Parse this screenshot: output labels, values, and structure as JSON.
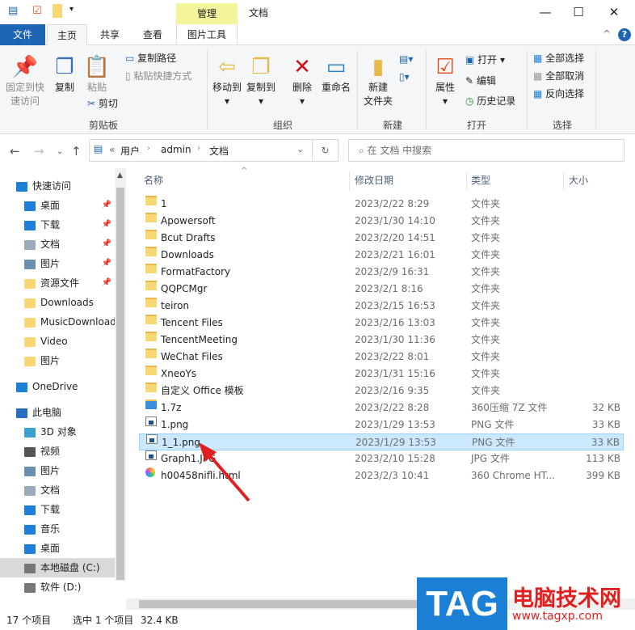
{
  "window": {
    "title": "文档",
    "context_tab": "管理",
    "minimize": "—",
    "maximize": "☐",
    "close": "✕"
  },
  "tabs": [
    {
      "label": "文件"
    },
    {
      "label": "主页"
    },
    {
      "label": "共享"
    },
    {
      "label": "查看"
    },
    {
      "label": "图片工具"
    }
  ],
  "ribbon": {
    "clipboard": {
      "pin": "固定到快速访问",
      "pin1": "固定到快",
      "pin2": "速访问",
      "copy": "复制",
      "paste": "粘贴",
      "copy_path": "复制路径",
      "paste_shortcut": "粘贴快捷方式",
      "cut": "剪切",
      "group": "剪贴板"
    },
    "organize": {
      "move_to": "移动到",
      "copy_to": "复制到",
      "delete": "删除",
      "rename": "重命名",
      "group": "组织"
    },
    "new": {
      "new_folder1": "新建",
      "new_folder2": "文件夹",
      "group": "新建"
    },
    "open": {
      "properties": "属性",
      "open": "打开",
      "edit": "编辑",
      "history": "历史记录",
      "group": "打开"
    },
    "select": {
      "select_all": "全部选择",
      "select_none": "全部取消",
      "invert": "反向选择",
      "group": "选择"
    }
  },
  "address": {
    "overflow": "«",
    "crumbs": [
      "用户",
      "admin",
      "文档"
    ],
    "search_placeholder": "在 文档 中搜索"
  },
  "sidebar": [
    {
      "label": "快速访问",
      "icon": "star-icon",
      "pinned": false
    },
    {
      "label": "桌面",
      "icon": "desktop-icon",
      "pinned": true
    },
    {
      "label": "下载",
      "icon": "download-icon",
      "pinned": true
    },
    {
      "label": "文档",
      "icon": "document-icon",
      "pinned": true
    },
    {
      "label": "图片",
      "icon": "pictures-icon",
      "pinned": true
    },
    {
      "label": "资源文件",
      "icon": "folder-icon",
      "pinned": true
    },
    {
      "label": "Downloads",
      "icon": "folder-icon",
      "pinned": false
    },
    {
      "label": "MusicDownload",
      "icon": "folder-icon",
      "pinned": false
    },
    {
      "label": "Video",
      "icon": "folder-icon",
      "pinned": false
    },
    {
      "label": "图片",
      "icon": "folder-icon",
      "pinned": false
    },
    {
      "label": "OneDrive",
      "icon": "cloud-icon",
      "pinned": false
    },
    {
      "label": "此电脑",
      "icon": "computer-icon",
      "pinned": false
    },
    {
      "label": "3D 对象",
      "icon": "cube-icon",
      "pinned": false
    },
    {
      "label": "视频",
      "icon": "video-icon",
      "pinned": false
    },
    {
      "label": "图片",
      "icon": "pictures-icon",
      "pinned": false
    },
    {
      "label": "文档",
      "icon": "document-icon",
      "pinned": false
    },
    {
      "label": "下载",
      "icon": "download-icon",
      "pinned": false
    },
    {
      "label": "音乐",
      "icon": "music-icon",
      "pinned": false
    },
    {
      "label": "桌面",
      "icon": "desktop-icon",
      "pinned": false
    },
    {
      "label": "本地磁盘 (C:)",
      "icon": "drive-icon",
      "pinned": false,
      "selected": true
    },
    {
      "label": "软件 (D:)",
      "icon": "drive-icon",
      "pinned": false
    }
  ],
  "columns": {
    "name": "名称",
    "date": "修改日期",
    "type": "类型",
    "size": "大小"
  },
  "files": [
    {
      "name": "1",
      "date": "2023/2/22 8:29",
      "type": "文件夹",
      "size": "",
      "icon": "folder"
    },
    {
      "name": "Apowersoft",
      "date": "2023/1/30 14:10",
      "type": "文件夹",
      "size": "",
      "icon": "folder"
    },
    {
      "name": "Bcut Drafts",
      "date": "2023/2/20 14:51",
      "type": "文件夹",
      "size": "",
      "icon": "folder"
    },
    {
      "name": "Downloads",
      "date": "2023/2/21 16:01",
      "type": "文件夹",
      "size": "",
      "icon": "folder"
    },
    {
      "name": "FormatFactory",
      "date": "2023/2/9 16:31",
      "type": "文件夹",
      "size": "",
      "icon": "folder"
    },
    {
      "name": "QQPCMgr",
      "date": "2023/2/1 8:16",
      "type": "文件夹",
      "size": "",
      "icon": "folder"
    },
    {
      "name": "teiron",
      "date": "2023/2/15 16:53",
      "type": "文件夹",
      "size": "",
      "icon": "folder"
    },
    {
      "name": "Tencent Files",
      "date": "2023/2/16 13:03",
      "type": "文件夹",
      "size": "",
      "icon": "folder"
    },
    {
      "name": "TencentMeeting",
      "date": "2023/1/30 11:36",
      "type": "文件夹",
      "size": "",
      "icon": "folder"
    },
    {
      "name": "WeChat Files",
      "date": "2023/2/22 8:01",
      "type": "文件夹",
      "size": "",
      "icon": "folder"
    },
    {
      "name": "XneoYs",
      "date": "2023/1/31 15:16",
      "type": "文件夹",
      "size": "",
      "icon": "folder"
    },
    {
      "name": "自定义 Office 模板",
      "date": "2023/2/16 9:35",
      "type": "文件夹",
      "size": "",
      "icon": "folder"
    },
    {
      "name": "1.7z",
      "date": "2023/2/22 8:28",
      "type": "360压缩 7Z 文件",
      "size": "32 KB",
      "icon": "zip"
    },
    {
      "name": "1.png",
      "date": "2023/1/29 13:53",
      "type": "PNG 文件",
      "size": "33 KB",
      "icon": "doc"
    },
    {
      "name": "1_1.png",
      "date": "2023/1/29 13:53",
      "type": "PNG 文件",
      "size": "33 KB",
      "icon": "doc",
      "selected": true
    },
    {
      "name": "Graph1.JPG",
      "date": "2023/2/10 15:28",
      "type": "JPG 文件",
      "size": "113 KB",
      "icon": "doc"
    },
    {
      "name": "h00458nifli.html",
      "date": "2023/2/3 10:41",
      "type": "360 Chrome HT...",
      "size": "399 KB",
      "icon": "web"
    }
  ],
  "status": {
    "count": "17 个项目",
    "selection": "选中 1 个项目",
    "size": "32.4 KB"
  },
  "watermark": {
    "logo": "TAG",
    "site": "电脑技术网",
    "url": "www.tagxp.com"
  },
  "colors": {
    "accent": "#1e64b4",
    "selection": "#cce8ff",
    "manage_tab": "#f4f49c",
    "arrow": "#e02020"
  }
}
